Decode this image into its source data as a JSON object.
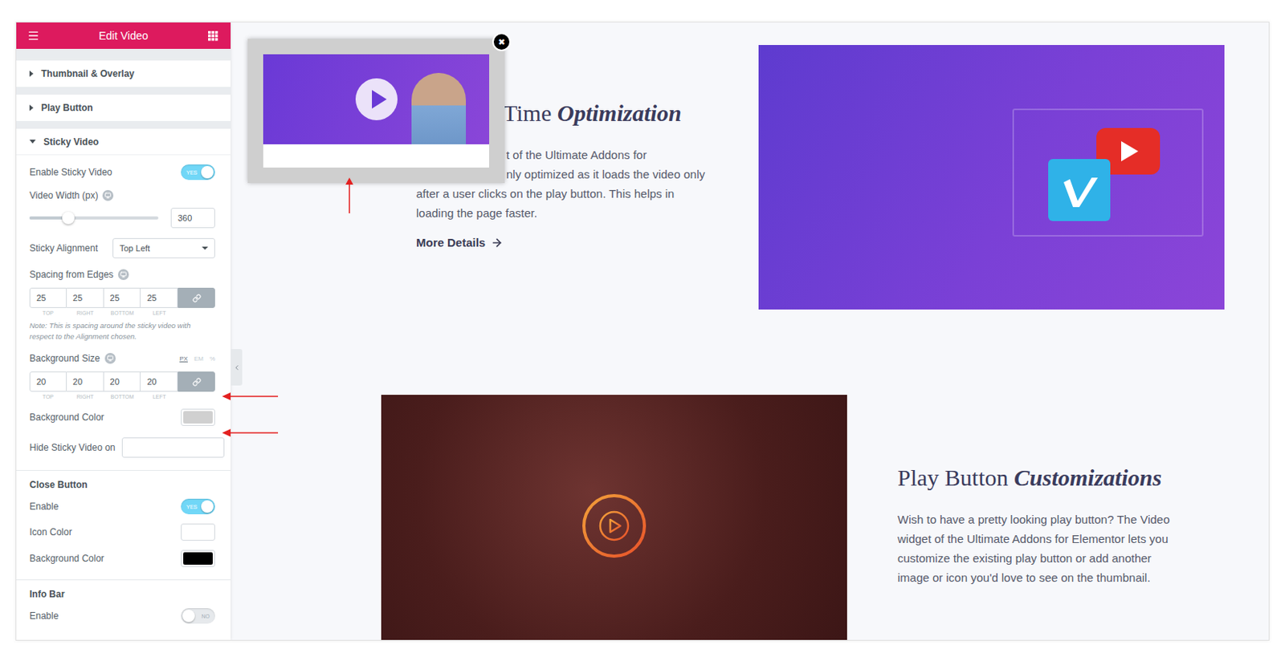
{
  "panel": {
    "title": "Edit Video",
    "sections": [
      {
        "title": "Thumbnail & Overlay",
        "expanded": false
      },
      {
        "title": "Play Button",
        "expanded": false
      },
      {
        "title": "Sticky Video",
        "expanded": true
      }
    ],
    "controls": [
      {
        "kind": "toggle",
        "label": "Enable Sticky Video",
        "on": true,
        "state": "YES"
      },
      {
        "kind": "slider",
        "label": "Video Width (px)",
        "responsive": true,
        "level": 0.3,
        "value": "360"
      },
      {
        "kind": "select",
        "label": "Sticky Alignment",
        "value": "Top Left"
      },
      {
        "kind": "dimensions",
        "label": "Spacing from Edges",
        "responsive": true,
        "units": [],
        "values": [
          "25",
          "25",
          "25",
          "25"
        ],
        "sides": [
          "TOP",
          "RIGHT",
          "BOTTOM",
          "LEFT"
        ],
        "linked": true
      },
      {
        "kind": "note",
        "text": "Note: This is spacing around the sticky video with respect to the Alignment chosen."
      },
      {
        "kind": "dimensions",
        "label": "Background Size",
        "responsive": true,
        "units": [
          {
            "label": "PX",
            "selected": true
          },
          {
            "label": "EM",
            "selected": false
          },
          {
            "label": "%",
            "selected": false
          }
        ],
        "values": [
          "20",
          "20",
          "20",
          "20"
        ],
        "sides": [
          "TOP",
          "RIGHT",
          "BOTTOM",
          "LEFT"
        ],
        "linked": true
      },
      {
        "kind": "color",
        "label": "Background Color",
        "color": "#d0d0d0"
      },
      {
        "kind": "text",
        "label": "Hide Sticky Video on",
        "value": ""
      },
      {
        "kind": "group",
        "label": "Close Button"
      },
      {
        "kind": "toggle",
        "label": "Enable",
        "on": true,
        "state": "YES"
      },
      {
        "kind": "color",
        "label": "Icon Color",
        "color": "#ffffff"
      },
      {
        "kind": "color",
        "label": "Background Color",
        "color": "#000000"
      },
      {
        "kind": "group",
        "label": "Info Bar"
      },
      {
        "kind": "toggle",
        "label": "Enable",
        "on": false,
        "state": "NO"
      }
    ]
  },
  "preview": {
    "sticky_video": {
      "close": "✖"
    },
    "feature_1": {
      "title_plain": "Time ",
      "title_em": "Optimization",
      "title_covered": true,
      "lines": [
        {
          "text": "t of the Ultimate Addons for",
          "covered": true
        },
        {
          "text": "nly optimized as it loads the video only",
          "covered": true
        },
        {
          "text": "after a user clicks on the play button. This helps in",
          "covered": false
        },
        {
          "text": "loading the page faster.",
          "covered": false
        }
      ],
      "link": "More Details"
    },
    "feature_2": {
      "title_plain": "Play Button ",
      "title_em": "Customizations",
      "title_covered": false,
      "lines": [
        {
          "text": "Wish to have a pretty looking play button? The Video",
          "covered": false
        },
        {
          "text": "widget of the Ultimate Addons for Elementor lets you",
          "covered": false
        },
        {
          "text": "customize the existing play button or add another",
          "covered": false
        },
        {
          "text": "image or icon you'd love to see on the thumbnail.",
          "covered": false
        }
      ]
    }
  }
}
